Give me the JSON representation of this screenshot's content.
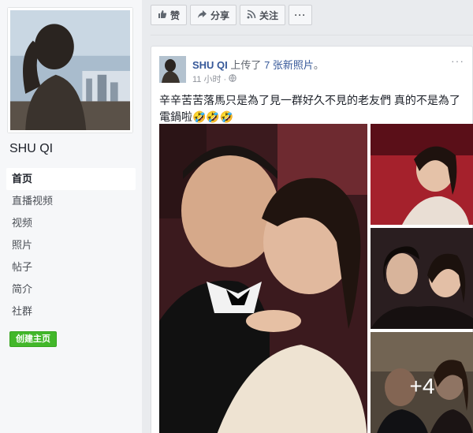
{
  "sidebar": {
    "page_name": "SHU QI",
    "nav": [
      {
        "label": "首页",
        "active": true
      },
      {
        "label": "直播视频"
      },
      {
        "label": "视频"
      },
      {
        "label": "照片"
      },
      {
        "label": "帖子"
      },
      {
        "label": "简介"
      },
      {
        "label": "社群"
      }
    ],
    "create_page_label": "创建主页"
  },
  "action_bar": {
    "like_label": "赞",
    "share_label": "分享",
    "follow_label": "关注",
    "more_icon": "more-icon"
  },
  "post": {
    "author": "SHU QI",
    "action_text": "上传了",
    "photos_link": "7 张新照片",
    "period": "。",
    "timestamp": "11 小时 ·",
    "privacy_icon": "globe-icon",
    "text": "辛辛苦苦落馬只是為了見一群好久不見的老友們 真的不是為了電鍋啦🤣🤣🤣",
    "more_photos_label": "+4"
  },
  "colors": {
    "link": "#365899",
    "create_button": "#42b72a",
    "background": "#e9ebee"
  }
}
